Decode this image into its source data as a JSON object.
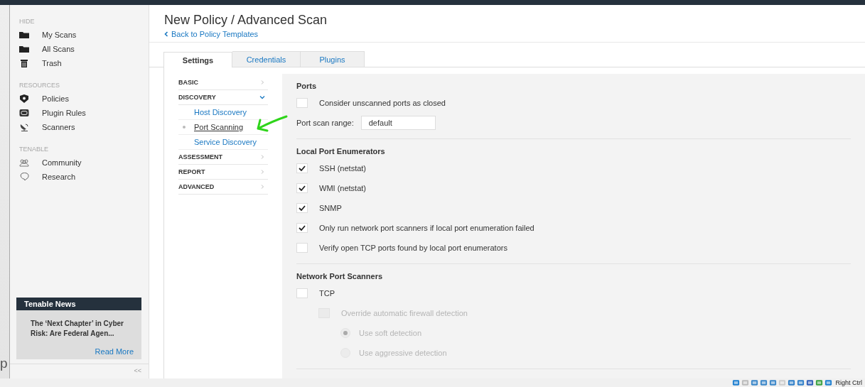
{
  "desktop_text": "p",
  "sidebar": {
    "sections": [
      {
        "heading": "HIDE",
        "items": [
          {
            "label": "My Scans"
          },
          {
            "label": "All Scans"
          },
          {
            "label": "Trash"
          }
        ]
      },
      {
        "heading": "RESOURCES",
        "items": [
          {
            "label": "Policies"
          },
          {
            "label": "Plugin Rules"
          },
          {
            "label": "Scanners"
          }
        ]
      },
      {
        "heading": "TENABLE",
        "items": [
          {
            "label": "Community"
          },
          {
            "label": "Research"
          }
        ]
      }
    ],
    "news": {
      "title": "Tenable News",
      "headline": "The ‘Next Chapter’ in Cyber Risk: Are Federal Agen...",
      "link": "Read More"
    },
    "collapse": "<<"
  },
  "page": {
    "title": "New Policy / Advanced Scan",
    "back_link": "Back to Policy Templates"
  },
  "tabs": [
    {
      "label": "Settings",
      "selected": true
    },
    {
      "label": "Credentials",
      "selected": false
    },
    {
      "label": "Plugins",
      "selected": false
    }
  ],
  "nav": [
    {
      "label": "BASIC",
      "expanded": false
    },
    {
      "label": "DISCOVERY",
      "expanded": true,
      "children": [
        {
          "label": "Host Discovery",
          "selected": false
        },
        {
          "label": "Port Scanning",
          "selected": true
        },
        {
          "label": "Service Discovery",
          "selected": false
        }
      ]
    },
    {
      "label": "ASSESSMENT",
      "expanded": false
    },
    {
      "label": "REPORT",
      "expanded": false
    },
    {
      "label": "ADVANCED",
      "expanded": false
    }
  ],
  "sections": [
    {
      "title": "Ports",
      "rows": [
        {
          "kind": "checkbox",
          "label": "Consider unscanned ports as closed",
          "checked": false,
          "disabled": false
        },
        {
          "kind": "text_field",
          "label": "Port scan range:",
          "value": "default"
        }
      ]
    },
    {
      "title": "Local Port Enumerators",
      "rows": [
        {
          "kind": "checkbox",
          "label": "SSH (netstat)",
          "checked": true,
          "disabled": false
        },
        {
          "kind": "checkbox",
          "label": "WMI (netstat)",
          "checked": true,
          "disabled": false
        },
        {
          "kind": "checkbox",
          "label": "SNMP",
          "checked": true,
          "disabled": false
        },
        {
          "kind": "checkbox",
          "label": "Only run network port scanners if local port enumeration failed",
          "checked": true,
          "disabled": false
        },
        {
          "kind": "checkbox",
          "label": "Verify open TCP ports found by local port enumerators",
          "checked": false,
          "disabled": false
        }
      ]
    },
    {
      "title": "Network Port Scanners",
      "rows": [
        {
          "kind": "checkbox",
          "label": "TCP",
          "checked": false,
          "disabled": false,
          "children": [
            {
              "kind": "checkbox",
              "label": "Override automatic firewall detection",
              "checked": false,
              "disabled": true,
              "children": [
                {
                  "kind": "radio",
                  "label": "Use soft detection",
                  "selected": true,
                  "disabled": true
                },
                {
                  "kind": "radio",
                  "label": "Use aggressive detection",
                  "selected": false,
                  "disabled": true
                }
              ]
            }
          ]
        }
      ]
    }
  ],
  "status_bar": {
    "hotkey": "Right Ctrl"
  }
}
